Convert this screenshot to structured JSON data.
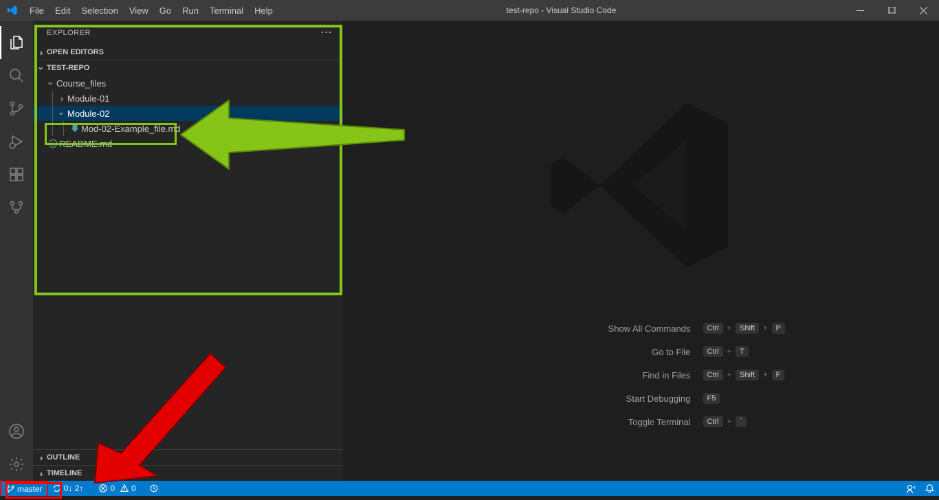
{
  "titleBar": {
    "menu": [
      "File",
      "Edit",
      "Selection",
      "View",
      "Go",
      "Run",
      "Terminal",
      "Help"
    ],
    "title": "test-repo - Visual Studio Code"
  },
  "sidebar": {
    "headerLabel": "EXPLORER",
    "sections": {
      "openEditors": "OPEN EDITORS",
      "repo": "TEST-REPO",
      "outline": "OUTLINE",
      "timeline": "TIMELINE"
    },
    "tree": {
      "courseFiles": "Course_files",
      "module01": "Module-01",
      "module02": "Module-02",
      "exampleFile": "Mod-02-Example_file.md",
      "readme": "README.md"
    }
  },
  "welcome": {
    "actions": [
      {
        "label": "Show All Commands",
        "keys": [
          "Ctrl",
          "Shift",
          "P"
        ]
      },
      {
        "label": "Go to File",
        "keys": [
          "Ctrl",
          "T"
        ]
      },
      {
        "label": "Find in Files",
        "keys": [
          "Ctrl",
          "Shift",
          "F"
        ]
      },
      {
        "label": "Start Debugging",
        "keys": [
          "F5"
        ]
      },
      {
        "label": "Toggle Terminal",
        "keys": [
          "Ctrl",
          "`"
        ]
      }
    ]
  },
  "statusBar": {
    "branch": "master",
    "sync": "0↓ 2↑",
    "errors": "0",
    "warnings": "0"
  },
  "colors": {
    "accent": "#007acc",
    "annotationGreen": "#86c517",
    "annotationRed": "#ff0000"
  }
}
